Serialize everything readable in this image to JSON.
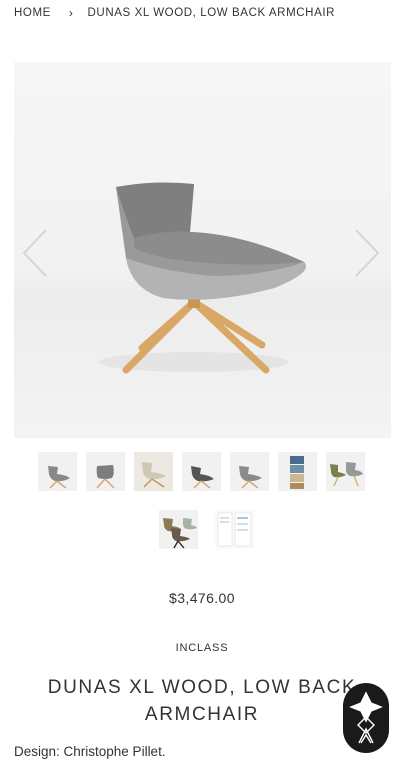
{
  "breadcrumb": {
    "home": "HOME",
    "separator": "›",
    "current": "DUNAS XL WOOD, LOW BACK ARMCHAIR"
  },
  "gallery": {
    "main_image": "chair-product-photo",
    "prev_icon": "chevron-left-icon",
    "next_icon": "chevron-right-icon",
    "thumbnail_count": 9
  },
  "product": {
    "price": "$3,476.00",
    "vendor": "INCLASS",
    "title": "DUNAS XL WOOD, LOW BACK ARMCHAIR",
    "design": "Design: Christophe Pillet."
  },
  "colors": {
    "text": "#333333",
    "badge": "#1a1a1a",
    "chair_upholstery": "#8f8f8f",
    "chair_wood": "#d9a766"
  }
}
